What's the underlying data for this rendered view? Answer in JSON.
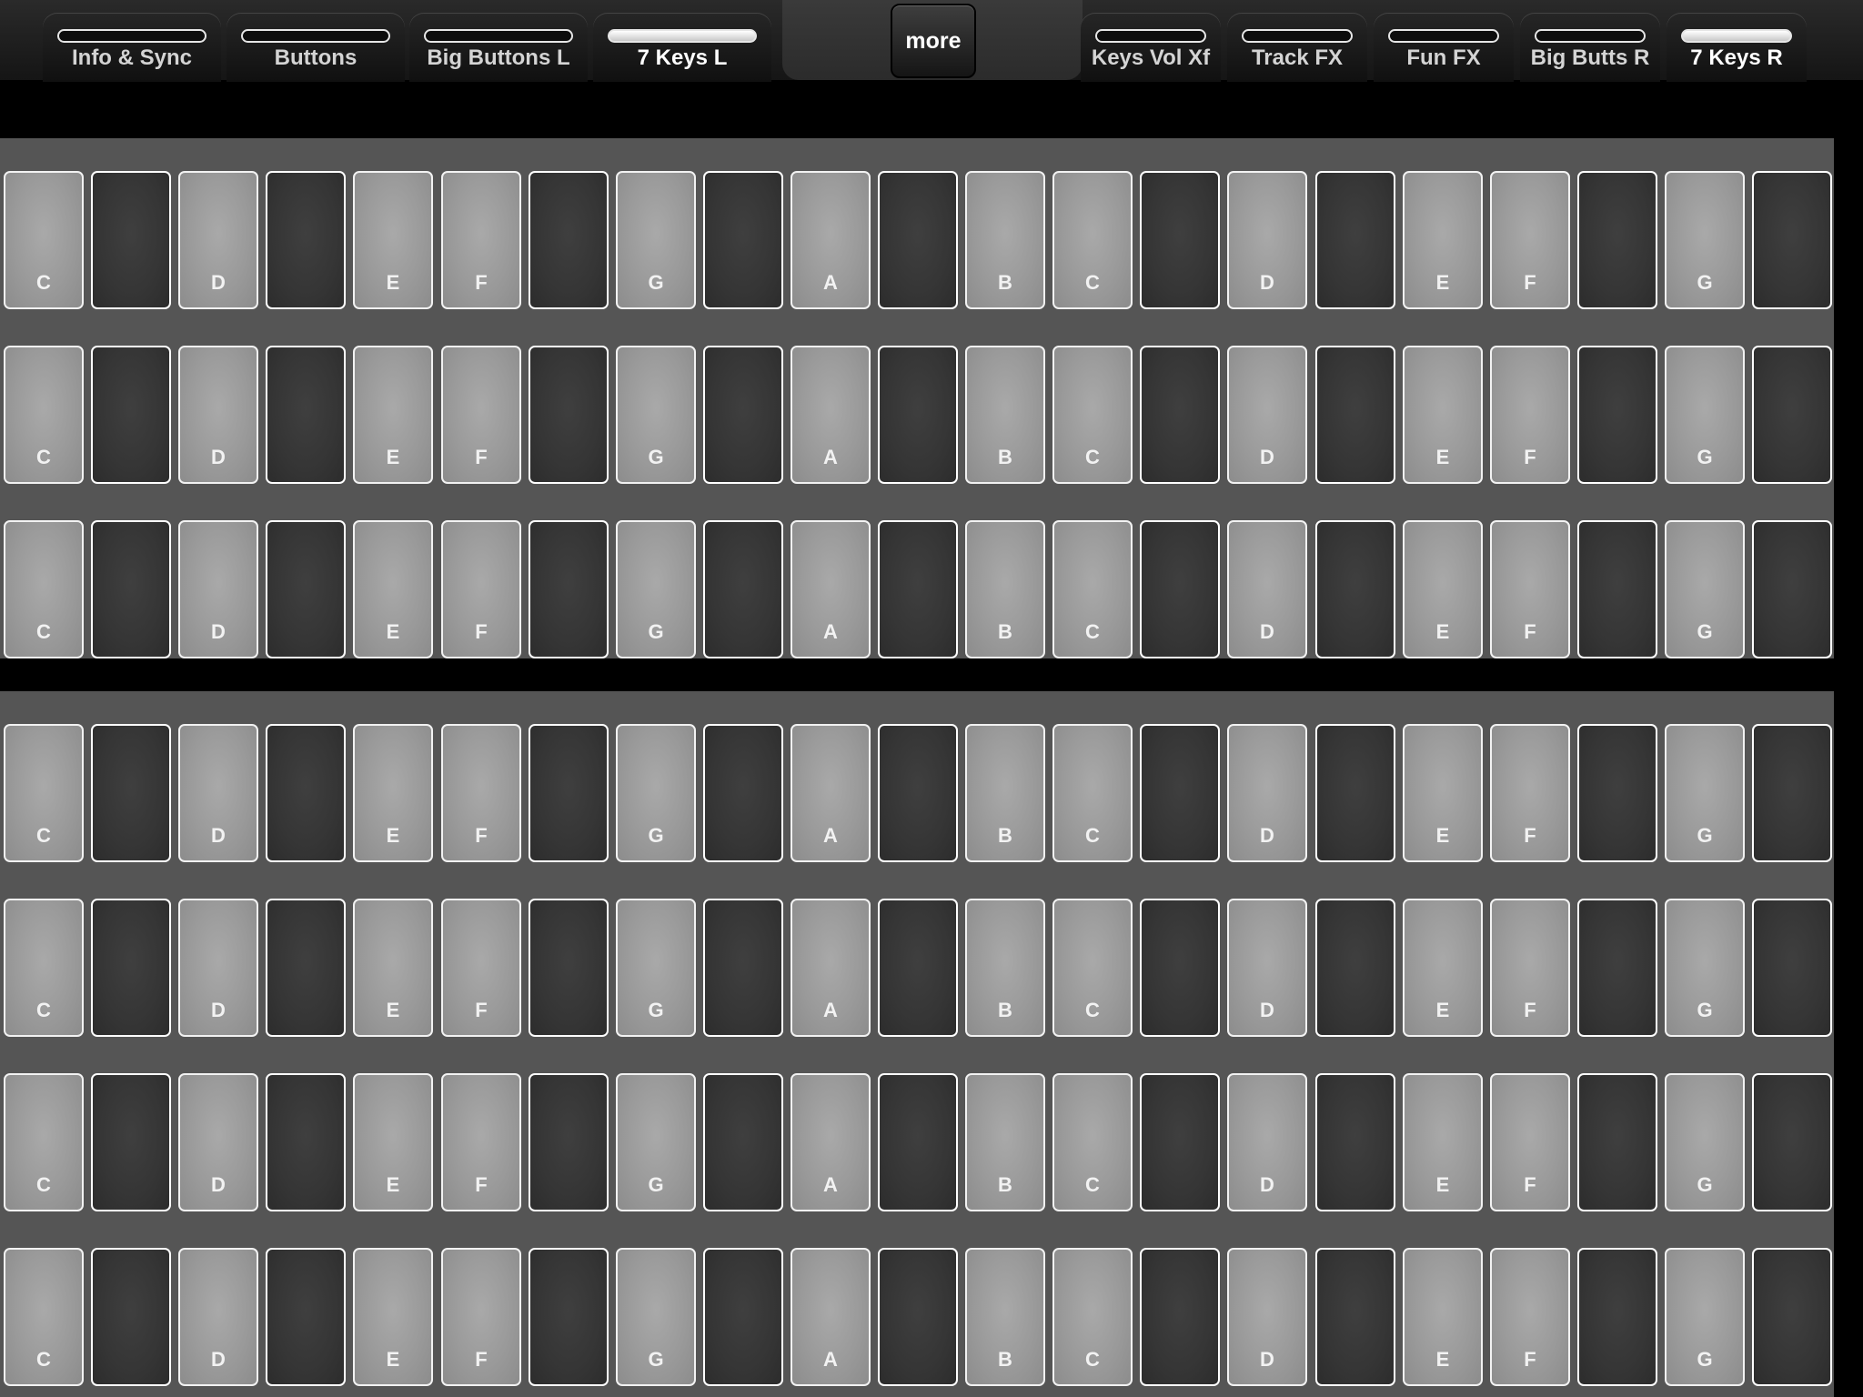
{
  "tabs_left": [
    {
      "label": "Info & Sync",
      "active": false
    },
    {
      "label": "Buttons",
      "active": false
    },
    {
      "label": "Big Buttons L",
      "active": false
    },
    {
      "label": "7 Keys L",
      "active": true
    }
  ],
  "more_label": "more",
  "tabs_right": [
    {
      "label": "Keys Vol Xf",
      "active": false
    },
    {
      "label": "Track FX",
      "active": false
    },
    {
      "label": "Fun FX",
      "active": false
    },
    {
      "label": "Big Butts R",
      "active": false
    },
    {
      "label": "7 Keys R",
      "active": true
    }
  ],
  "keyboard": {
    "keys": [
      {
        "type": "white",
        "note": "C"
      },
      {
        "type": "black",
        "note": ""
      },
      {
        "type": "white",
        "note": "D"
      },
      {
        "type": "black",
        "note": ""
      },
      {
        "type": "white",
        "note": "E"
      },
      {
        "type": "white",
        "note": "F"
      },
      {
        "type": "black",
        "note": ""
      },
      {
        "type": "white",
        "note": "G"
      },
      {
        "type": "black",
        "note": ""
      },
      {
        "type": "white",
        "note": "A"
      },
      {
        "type": "black",
        "note": ""
      },
      {
        "type": "white",
        "note": "B"
      },
      {
        "type": "white",
        "note": "C"
      },
      {
        "type": "black",
        "note": ""
      },
      {
        "type": "white",
        "note": "D"
      },
      {
        "type": "black",
        "note": ""
      },
      {
        "type": "white",
        "note": "E"
      },
      {
        "type": "white",
        "note": "F"
      },
      {
        "type": "black",
        "note": ""
      },
      {
        "type": "white",
        "note": "G"
      },
      {
        "type": "black",
        "note": ""
      }
    ],
    "top_panel_row_count": 3,
    "bottom_panel_row_count": 4
  },
  "colors": {
    "background": "#000000",
    "panel": "#555555",
    "white_key": "#9a9a9a",
    "black_key": "#353535",
    "key_border": "#f2f2f2",
    "active_indicator": "#ffffff"
  }
}
